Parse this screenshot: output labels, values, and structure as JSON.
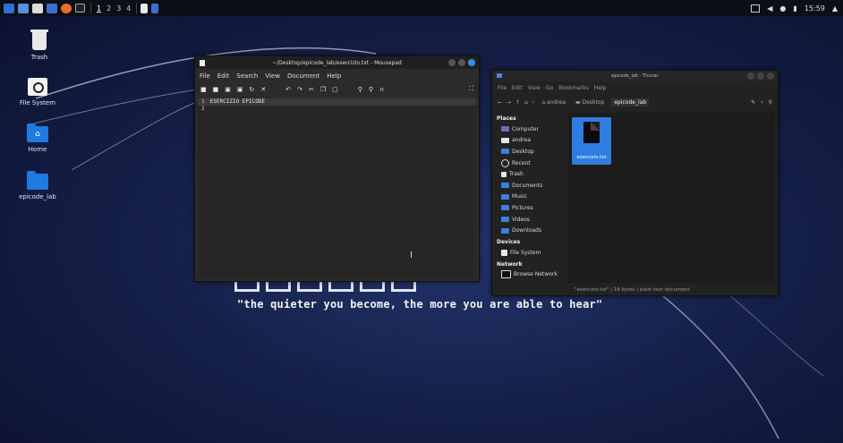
{
  "panel": {
    "workspaces": [
      "1",
      "2",
      "3",
      "4"
    ],
    "active_workspace": "1",
    "clock": "15:59"
  },
  "desktop": {
    "icons": [
      {
        "label": "Trash"
      },
      {
        "label": "File System"
      },
      {
        "label": "Home"
      },
      {
        "label": "epicode_lab"
      }
    ]
  },
  "mousepad": {
    "title": "~/Desktop/epicode_lab/esercizio.txt - Mousepad",
    "menu": [
      "File",
      "Edit",
      "Search",
      "View",
      "Document",
      "Help"
    ],
    "lines": [
      {
        "num": "1",
        "text": "ESERCIZIO EPICODE"
      },
      {
        "num": "2",
        "text": ""
      }
    ]
  },
  "thunar": {
    "title": "epicode_lab - Thunar",
    "menu": [
      "File",
      "Edit",
      "View",
      "Go",
      "Bookmarks",
      "Help"
    ],
    "path": [
      "andrea",
      "Desktop",
      "epicode_lab"
    ],
    "places_header": "Places",
    "places": [
      "Computer",
      "andrea",
      "Desktop",
      "Recent",
      "Trash",
      "Documents",
      "Music",
      "Pictures",
      "Videos",
      "Downloads"
    ],
    "devices_header": "Devices",
    "devices": [
      "File System"
    ],
    "network_header": "Network",
    "network": [
      "Browse Network"
    ],
    "file_name": "esercizio.txt",
    "status": "\"esercizio.txt\" | 18 bytes | plain text document"
  },
  "tagline": "\"the quieter you become, the more you are able to hear\"",
  "colors": {
    "accent": "#2f7de0",
    "panel_bg": "#0c0f17"
  }
}
